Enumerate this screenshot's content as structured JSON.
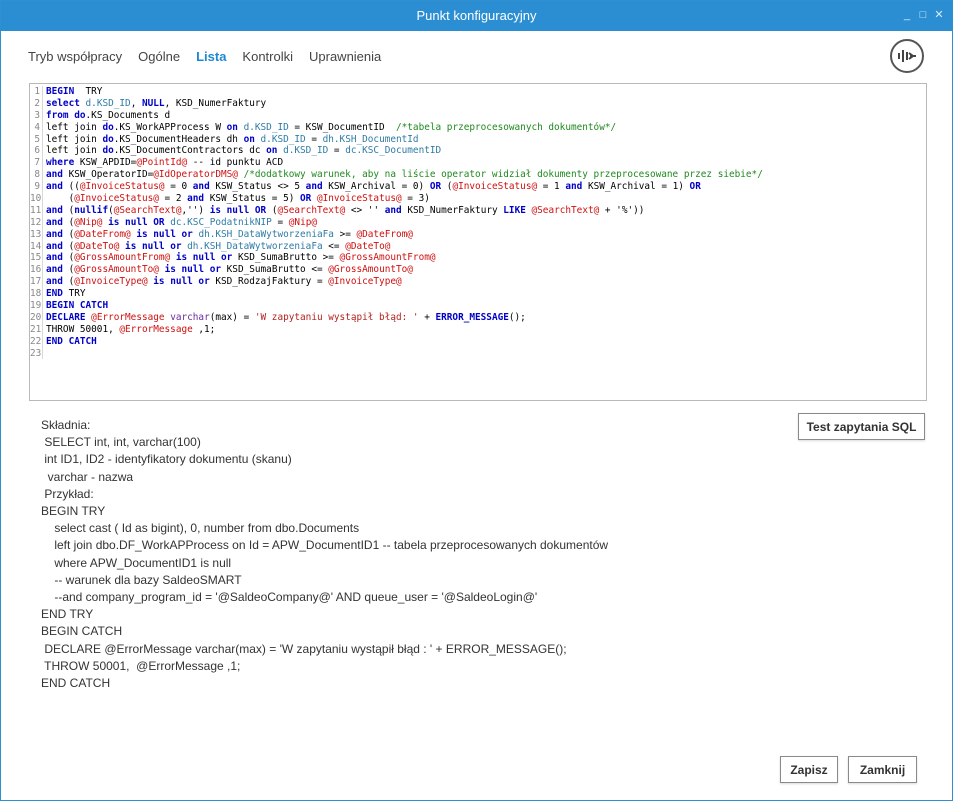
{
  "window": {
    "title": "Punkt konfiguracyjny",
    "controls": [
      "_",
      "□",
      "✕"
    ]
  },
  "tabs": [
    {
      "label": "Tryb współpracy",
      "active": false
    },
    {
      "label": "Ogólne",
      "active": false
    },
    {
      "label": "Lista",
      "active": true
    },
    {
      "label": "Kontrolki",
      "active": false
    },
    {
      "label": "Uprawnienia",
      "active": false
    }
  ],
  "ribbon_icon": "ribbon-toggle-icon",
  "editor": {
    "lines": [
      [
        [
          "kw",
          "BEGIN"
        ],
        [
          "",
          "  TRY"
        ]
      ],
      [
        [
          "kw",
          "select"
        ],
        [
          "",
          " "
        ],
        [
          "id",
          "d.KSD_ID"
        ],
        [
          "",
          ", "
        ],
        [
          "kw",
          "NULL"
        ],
        [
          "",
          ", KSD_NumerFaktury"
        ]
      ],
      [
        [
          "kw",
          "from"
        ],
        [
          "",
          " "
        ],
        [
          "kw",
          "do"
        ],
        [
          "",
          ".KS_Documents d"
        ]
      ],
      [
        [
          "",
          "left join "
        ],
        [
          "kw",
          "do"
        ],
        [
          "",
          ".KS_WorkAPProcess W "
        ],
        [
          "kw",
          "on"
        ],
        [
          "",
          " "
        ],
        [
          "id",
          "d.KSD_ID"
        ],
        [
          "",
          " = KSW_DocumentID  "
        ],
        [
          "cm",
          "/*tabela przeprocesowanych dokumentów*/"
        ]
      ],
      [
        [
          "",
          "left join "
        ],
        [
          "kw",
          "do"
        ],
        [
          "",
          ".KS_DocumentHeaders dh "
        ],
        [
          "kw",
          "on"
        ],
        [
          "",
          " "
        ],
        [
          "id",
          "d.KSD_ID"
        ],
        [
          "",
          " = "
        ],
        [
          "id",
          "dh.KSH_DocumentId"
        ]
      ],
      [
        [
          "",
          "left join "
        ],
        [
          "kw",
          "do"
        ],
        [
          "",
          ".KS_DocumentContractors dc "
        ],
        [
          "kw",
          "on"
        ],
        [
          "",
          " "
        ],
        [
          "id",
          "d.KSD_ID"
        ],
        [
          "",
          " = "
        ],
        [
          "id",
          "dc.KSC_DocumentID"
        ]
      ],
      [
        [
          "kw",
          "where"
        ],
        [
          "",
          " KSW_APDID="
        ],
        [
          "var",
          "@PointId@"
        ],
        [
          "",
          " -- id punktu ACD"
        ]
      ],
      [
        [
          "kw",
          "and"
        ],
        [
          "",
          " KSW_OperatorID="
        ],
        [
          "var",
          "@IdOperatorDMS@"
        ],
        [
          "",
          " "
        ],
        [
          "cm",
          "/*dodatkowy warunek, aby na liście operator widział dokumenty przeprocesowane przez siebie*/"
        ]
      ],
      [
        [
          "kw",
          "and"
        ],
        [
          "",
          " (("
        ],
        [
          "var",
          "@InvoiceStatus@"
        ],
        [
          "",
          " = 0 "
        ],
        [
          "kw",
          "and"
        ],
        [
          "",
          " KSW_Status <> 5 "
        ],
        [
          "kw",
          "and"
        ],
        [
          "",
          " KSW_Archival = 0) "
        ],
        [
          "kw",
          "OR"
        ],
        [
          "",
          " ("
        ],
        [
          "var",
          "@InvoiceStatus@"
        ],
        [
          "",
          " = 1 "
        ],
        [
          "kw",
          "and"
        ],
        [
          "",
          " KSW_Archival = 1) "
        ],
        [
          "kw",
          "OR"
        ]
      ],
      [
        [
          "",
          "    ("
        ],
        [
          "var",
          "@InvoiceStatus@"
        ],
        [
          "",
          " = 2 "
        ],
        [
          "kw",
          "and"
        ],
        [
          "",
          " KSW_Status = 5) "
        ],
        [
          "kw",
          "OR"
        ],
        [
          "",
          " "
        ],
        [
          "var",
          "@InvoiceStatus@"
        ],
        [
          "",
          " = 3)"
        ]
      ],
      [
        [
          "kw",
          "and"
        ],
        [
          "",
          " ("
        ],
        [
          "kw",
          "nullif"
        ],
        [
          "",
          "("
        ],
        [
          "var",
          "@SearchText@"
        ],
        [
          "",
          ",'') "
        ],
        [
          "kw",
          "is null OR"
        ],
        [
          "",
          " ("
        ],
        [
          "var",
          "@SearchText@"
        ],
        [
          "",
          " <> '' "
        ],
        [
          "kw",
          "and"
        ],
        [
          "",
          " KSD_NumerFaktury "
        ],
        [
          "kw",
          "LIKE"
        ],
        [
          "",
          " "
        ],
        [
          "var",
          "@SearchText@"
        ],
        [
          "",
          " + '%'))"
        ]
      ],
      [
        [
          "kw",
          "and"
        ],
        [
          "",
          " ("
        ],
        [
          "var",
          "@Nip@"
        ],
        [
          "",
          " "
        ],
        [
          "kw",
          "is null OR"
        ],
        [
          "",
          " "
        ],
        [
          "id",
          "dc.KSC_PodatnikNIP"
        ],
        [
          "",
          " = "
        ],
        [
          "var",
          "@Nip@"
        ],
        [
          ")"
        ]
      ],
      [
        [
          "kw",
          "and"
        ],
        [
          "",
          " ("
        ],
        [
          "var",
          "@DateFrom@"
        ],
        [
          "",
          " "
        ],
        [
          "kw",
          "is null or"
        ],
        [
          "",
          " "
        ],
        [
          "id",
          "dh.KSH_DataWytworzeniaFa"
        ],
        [
          "",
          " >= "
        ],
        [
          "var",
          "@DateFrom@"
        ],
        [
          ")"
        ]
      ],
      [
        [
          "kw",
          "and"
        ],
        [
          "",
          " ("
        ],
        [
          "var",
          "@DateTo@"
        ],
        [
          "",
          " "
        ],
        [
          "kw",
          "is null or"
        ],
        [
          "",
          " "
        ],
        [
          "id",
          "dh.KSH_DataWytworzeniaFa"
        ],
        [
          "",
          " <= "
        ],
        [
          "var",
          "@DateTo@"
        ],
        [
          ")"
        ]
      ],
      [
        [
          "kw",
          "and"
        ],
        [
          "",
          " ("
        ],
        [
          "var",
          "@GrossAmountFrom@"
        ],
        [
          "",
          " "
        ],
        [
          "kw",
          "is null or"
        ],
        [
          "",
          " KSD_SumaBrutto >= "
        ],
        [
          "var",
          "@GrossAmountFrom@"
        ],
        [
          ")"
        ]
      ],
      [
        [
          "kw",
          "and"
        ],
        [
          "",
          " ("
        ],
        [
          "var",
          "@GrossAmountTo@"
        ],
        [
          "",
          " "
        ],
        [
          "kw",
          "is null or"
        ],
        [
          "",
          " KSD_SumaBrutto <= "
        ],
        [
          "var",
          "@GrossAmountTo@"
        ],
        [
          ")"
        ]
      ],
      [
        [
          "kw",
          "and"
        ],
        [
          "",
          " ("
        ],
        [
          "var",
          "@InvoiceType@"
        ],
        [
          "",
          " "
        ],
        [
          "kw",
          "is null or"
        ],
        [
          "",
          " KSD_RodzajFaktury = "
        ],
        [
          "var",
          "@InvoiceType@"
        ],
        [
          ")"
        ]
      ],
      [
        [
          "kw",
          "END"
        ],
        [
          "",
          " TRY"
        ]
      ],
      [
        [
          "kw",
          "BEGIN CATCH"
        ]
      ],
      [
        [
          "kw",
          "DECLARE"
        ],
        [
          "",
          " "
        ],
        [
          "var",
          "@ErrorMessage"
        ],
        [
          "",
          " "
        ],
        [
          "tp",
          "varchar"
        ],
        [
          "",
          "(max) = "
        ],
        [
          "st",
          "'W zapytaniu wystąpił błąd: '"
        ],
        [
          "",
          " + "
        ],
        [
          "kw",
          "ERROR_MESSAGE"
        ],
        [
          "",
          "();"
        ]
      ],
      [
        [
          "",
          "THROW 50001, "
        ],
        [
          "var",
          "@ErrorMessage"
        ],
        [
          "",
          " ,1;"
        ]
      ],
      [
        [
          "kw",
          "END CATCH"
        ]
      ],
      [
        [
          "",
          ""
        ]
      ]
    ]
  },
  "help_text": [
    "Składnia:",
    " SELECT int, int, varchar(100)",
    " int ID1, ID2 - identyfikatory dokumentu (skanu)",
    "  varchar - nazwa",
    " Przykład:",
    "BEGIN TRY",
    "    select cast ( Id as bigint), 0, number from dbo.Documents",
    "    left join dbo.DF_WorkAPProcess on Id = APW_DocumentID1 -- tabela przeprocesowanych dokumentów",
    "    where APW_DocumentID1 is null",
    "    -- warunek dla bazy SaldeoSMART",
    "    --and company_program_id = '@SaldeoCompany@' AND queue_user = '@SaldeoLogin@'",
    "END TRY",
    "BEGIN CATCH",
    " DECLARE @ErrorMessage varchar(max) = 'W zapytaniu wystąpił błąd : ' + ERROR_MESSAGE();",
    " THROW 50001,  @ErrorMessage ,1;",
    "END CATCH"
  ],
  "buttons": {
    "test_sql": "Test zapytania SQL",
    "save": "Zapisz",
    "close": "Zamknij"
  },
  "colors": {
    "title_bar": "#2b8ed3",
    "active_tab": "#1e88d0",
    "keyword": "#0000c8",
    "variable": "#d01010",
    "comment": "#1f8a1f"
  }
}
